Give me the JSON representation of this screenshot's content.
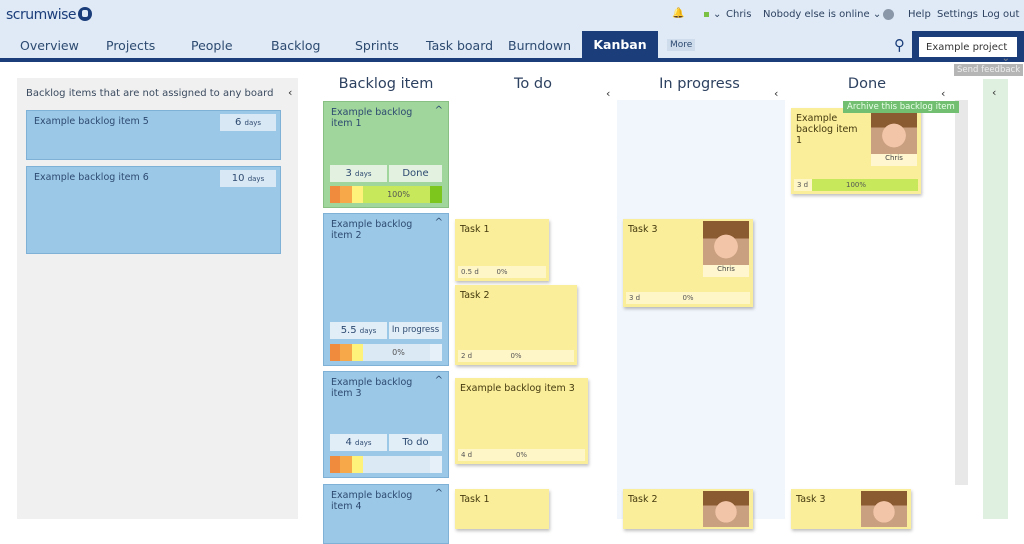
{
  "app": {
    "logo": "scrumwise"
  },
  "topbar": {
    "user": "Chris",
    "online": "Nobody else is online",
    "help": "Help",
    "settings": "Settings",
    "logout": "Log out",
    "status_color": "#7ac143"
  },
  "nav": {
    "tabs": [
      "Overview",
      "Projects",
      "People",
      "Backlog",
      "Sprints",
      "Task board",
      "Burndown",
      "Kanban"
    ],
    "active": "Kanban",
    "more": "More",
    "project": "Example project",
    "feedback": "Send feedback"
  },
  "left_panel": {
    "title": "Backlog items that are not assigned to any board",
    "items": [
      {
        "title": "Example backlog item 5",
        "days": "6",
        "unit": "days"
      },
      {
        "title": "Example backlog item 6",
        "days": "10",
        "unit": "days"
      }
    ]
  },
  "columns": [
    "Backlog item",
    "To do",
    "In progress",
    "Done"
  ],
  "tooltip": "Archive this backlog item",
  "backlog_items": [
    {
      "title": "Example backlog item 1",
      "days": "3",
      "unit": "days",
      "status": "Done",
      "progress": "100%"
    },
    {
      "title": "Example backlog item 2",
      "days": "5.5",
      "unit": "days",
      "status": "In progress",
      "progress": "0%"
    },
    {
      "title": "Example backlog item 3",
      "days": "4",
      "unit": "days",
      "status": "To do",
      "progress": ""
    },
    {
      "title": "Example backlog item 4"
    }
  ],
  "stickies": [
    {
      "title": "Example backlog item 1",
      "est": "3 d",
      "progress": "100%",
      "assignee": "Chris"
    },
    {
      "title": "Task 1",
      "est": "0.5 d",
      "progress": "0%"
    },
    {
      "title": "Task 2",
      "est": "2 d",
      "progress": "0%"
    },
    {
      "title": "Task 3",
      "est": "3 d",
      "progress": "0%",
      "assignee": "Chris"
    },
    {
      "title": "Example backlog item 3",
      "est": "4 d",
      "progress": "0%"
    },
    {
      "title": "Task 1"
    },
    {
      "title": "Task 2"
    },
    {
      "title": "Task 3"
    }
  ]
}
